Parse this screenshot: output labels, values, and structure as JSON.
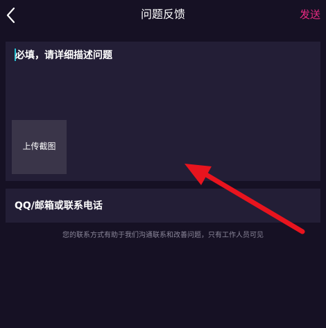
{
  "header": {
    "title": "问题反馈",
    "back_icon": "chevron-left-icon",
    "send_label": "发送"
  },
  "description": {
    "placeholder": "必填，请详细描述问题",
    "upload_label": "上传截图"
  },
  "contact": {
    "placeholder": "QQ/邮箱或联系电话"
  },
  "hint": "您的联系方式有助于我们沟通联系和改善问题，只有工作人员可见",
  "colors": {
    "background": "#161124",
    "panel": "#231e36",
    "upload_tile": "#3a3549",
    "accent": "#ea2a82",
    "caret": "#29c5d6",
    "annotation_arrow": "#e8141e"
  }
}
